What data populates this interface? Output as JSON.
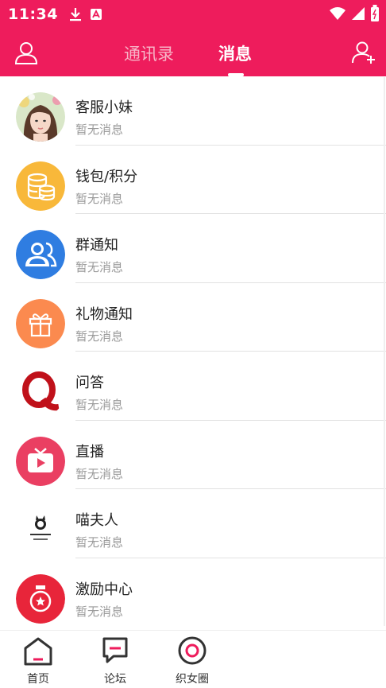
{
  "status_bar": {
    "time": "11:34"
  },
  "header": {
    "tabs": [
      {
        "label": "通讯录",
        "active": false
      },
      {
        "label": "消息",
        "active": true
      }
    ]
  },
  "messages": [
    {
      "name": "客服小妹",
      "preview": "暂无消息",
      "icon": "avatar-photo"
    },
    {
      "name": "钱包/积分",
      "preview": "暂无消息",
      "icon": "coins-icon",
      "color": "#f8b83a"
    },
    {
      "name": "群通知",
      "preview": "暂无消息",
      "icon": "group-icon",
      "color": "#2f7de1"
    },
    {
      "name": "礼物通知",
      "preview": "暂无消息",
      "icon": "gift-icon",
      "color": "#fb8a4f"
    },
    {
      "name": "问答",
      "preview": "暂无消息",
      "icon": "q-icon",
      "color": "#c0111a"
    },
    {
      "name": "直播",
      "preview": "暂无消息",
      "icon": "tv-icon",
      "color": "#ea3f62"
    },
    {
      "name": "喵夫人",
      "preview": "暂无消息",
      "icon": "cat-logo"
    },
    {
      "name": "激励中心",
      "preview": "暂无消息",
      "icon": "medal-icon",
      "color": "#e8253a"
    }
  ],
  "bottom_nav": [
    {
      "label": "首页",
      "icon": "home-icon"
    },
    {
      "label": "论坛",
      "icon": "forum-icon"
    },
    {
      "label": "织女圈",
      "icon": "circle-icon"
    }
  ],
  "colors": {
    "primary": "#ee1c5c"
  }
}
